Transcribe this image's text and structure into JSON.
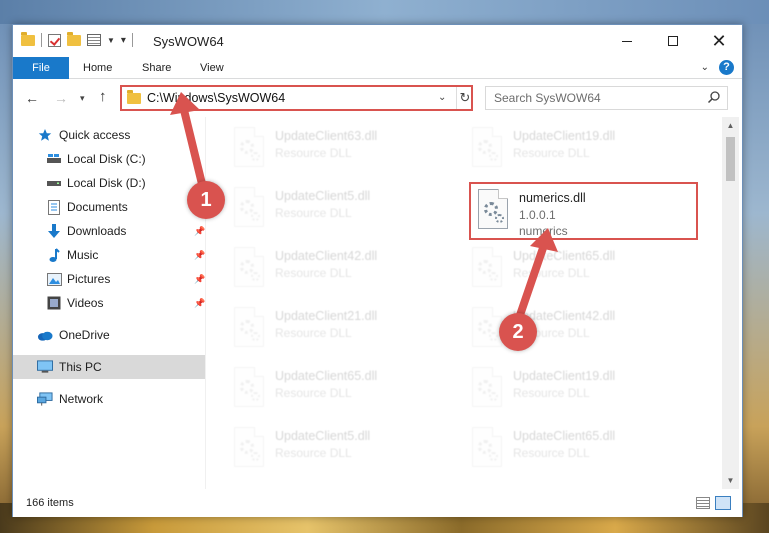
{
  "window": {
    "title": "SysWOW64"
  },
  "ribbon": {
    "tabs": [
      {
        "label": "File"
      },
      {
        "label": "Home"
      },
      {
        "label": "Share"
      },
      {
        "label": "View"
      }
    ],
    "help_label": "?"
  },
  "address": {
    "path": "C:\\Windows\\SysWOW64",
    "search_placeholder": "Search SysWOW64"
  },
  "sidebar": {
    "items": [
      {
        "label": "Quick access",
        "icon": "star-icon"
      },
      {
        "label": "Local Disk (C:)",
        "icon": "drive-icon"
      },
      {
        "label": "Local Disk (D:)",
        "icon": "drive-icon"
      },
      {
        "label": "Documents",
        "icon": "documents-icon"
      },
      {
        "label": "Downloads",
        "icon": "download-icon"
      },
      {
        "label": "Music",
        "icon": "music-icon"
      },
      {
        "label": "Pictures",
        "icon": "pictures-icon"
      },
      {
        "label": "Videos",
        "icon": "videos-icon"
      },
      {
        "label": "OneDrive",
        "icon": "cloud-icon"
      },
      {
        "label": "This PC",
        "icon": "computer-icon"
      },
      {
        "label": "Network",
        "icon": "network-icon"
      }
    ],
    "selected": "This PC"
  },
  "files": {
    "left_column": [
      {
        "name": "UpdateClient63.dll",
        "desc": "Resource DLL"
      },
      {
        "name": "UpdateClient5.dll",
        "desc": "Resource DLL"
      },
      {
        "name": "UpdateClient42.dll",
        "desc": "Resource DLL"
      },
      {
        "name": "UpdateClient21.dll",
        "desc": "Resource DLL"
      },
      {
        "name": "UpdateClient65.dll",
        "desc": "Resource DLL"
      },
      {
        "name": "UpdateClient5.dll",
        "desc": "Resource DLL"
      }
    ],
    "right_column": [
      {
        "name": "UpdateClient19.dll",
        "desc": "Resource DLL"
      },
      {
        "name": "numerics.dll",
        "desc": "1.0.0.1",
        "company": "numerics",
        "highlighted": true
      },
      {
        "name": "UpdateClient65.dll",
        "desc": "Resource DLL"
      },
      {
        "name": "UpdateClient42.dll",
        "desc": "Resource DLL"
      },
      {
        "name": "UpdateClient19.dll",
        "desc": "Resource DLL"
      },
      {
        "name": "UpdateClient65.dll",
        "desc": "Resource DLL"
      }
    ]
  },
  "status": {
    "item_count": "166 items"
  },
  "callouts": {
    "step1": "1",
    "step2": "2"
  },
  "colors": {
    "accent": "#1979ca",
    "highlight": "#d9534f",
    "selected_bg": "#d9d9d9"
  }
}
